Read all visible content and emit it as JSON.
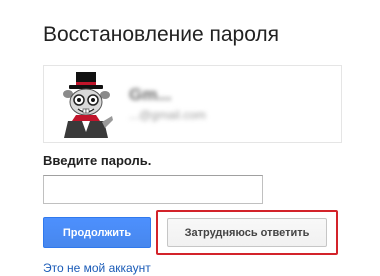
{
  "page": {
    "title": "Восстановление пароля"
  },
  "account": {
    "avatar_icon": "top-hat-rabbit-avatar-icon",
    "name": "Gm...",
    "email": "...@gmail.com"
  },
  "form": {
    "password_label": "Введите пароль.",
    "password_value": "",
    "password_placeholder": ""
  },
  "actions": {
    "continue_label": "Продолжить",
    "trouble_label": "Затрудняюсь ответить",
    "not_my_account_label": "Это не мой аккаунт"
  },
  "colors": {
    "primary_button": "#4d90fe",
    "highlight_frame": "#d3232a",
    "link": "#1a5bb7",
    "title_text": "#222222"
  }
}
